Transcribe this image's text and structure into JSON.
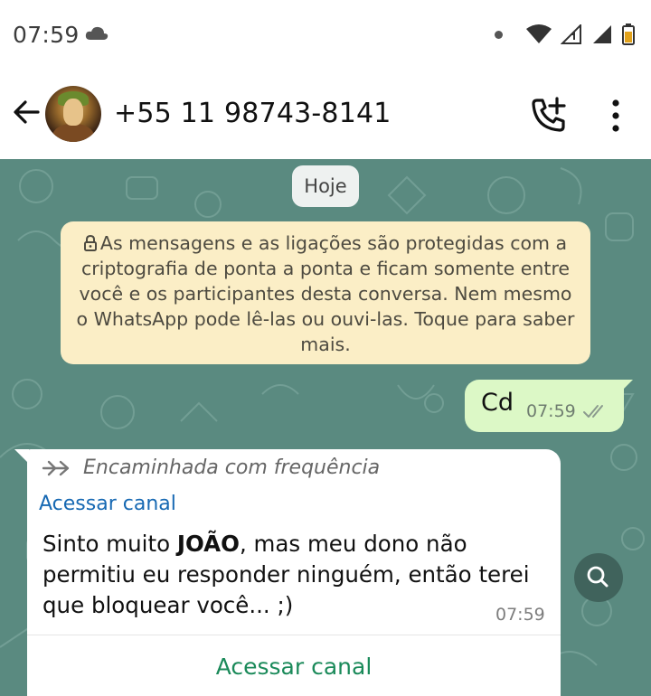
{
  "status_bar": {
    "time": "07:59"
  },
  "header": {
    "contact_name": "+55 11 98743-8141"
  },
  "chat": {
    "date_chip": "Hoje",
    "encryption_notice": "As mensagens e as ligações são protegidas com a criptografia de ponta a ponta e ficam somente entre você e os participantes desta conversa. Nem mesmo o WhatsApp pode lê-las ou ouvi-las. Toque para saber mais.",
    "outgoing": {
      "text": "Cd",
      "time": "07:59"
    },
    "incoming": {
      "forwarded_label": "Encaminhada com frequência",
      "channel_link": "Acessar canal",
      "text_before": "Sinto muito ",
      "text_bold": "JOÃO",
      "text_after": ", mas meu dono não permitiu eu responder ninguém, então terei que bloquear você... ;)",
      "time": "07:59",
      "button_label": "Acessar canal"
    }
  },
  "colors": {
    "chat_background": "#5a8a80",
    "outgoing_bubble": "#dcf8c6",
    "notice_bubble": "#fbeec6",
    "link": "#1769b3",
    "channel_button": "#1b8a5a"
  },
  "icons": [
    "cloud-icon",
    "wifi-icon",
    "signal-icon",
    "battery-icon",
    "back-arrow-icon",
    "add-call-icon",
    "more-vert-icon",
    "lock-icon",
    "double-check-icon",
    "forward-icon",
    "search-icon"
  ]
}
